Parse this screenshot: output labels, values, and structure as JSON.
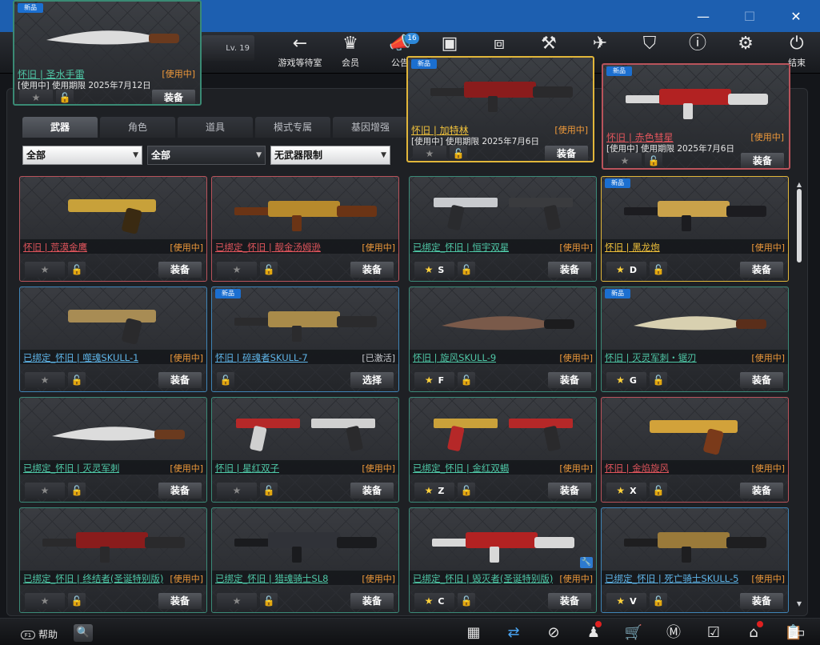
{
  "window": {
    "minimize": "—",
    "maximize": "☐",
    "close": "✕"
  },
  "profile": {
    "level": "Lv. 19"
  },
  "nav": [
    {
      "label": "游戏等待室",
      "icon": "back-arrow-icon",
      "glyph": "←"
    },
    {
      "label": "会员",
      "icon": "crown-icon",
      "glyph": "♛"
    },
    {
      "label": "公告",
      "icon": "megaphone-icon",
      "glyph": "📣"
    },
    {
      "label": "",
      "icon": "calendar-icon",
      "glyph": "▣"
    },
    {
      "label": "",
      "icon": "bag-icon",
      "glyph": "⧈"
    },
    {
      "label": "",
      "icon": "hammer-icon",
      "glyph": "⚒"
    },
    {
      "label": "",
      "icon": "ticket-icon",
      "glyph": "✈"
    },
    {
      "label": "",
      "icon": "clan-shield-icon",
      "glyph": "⛉"
    },
    {
      "label": "",
      "icon": "alert-icon",
      "glyph": "ⓘ"
    },
    {
      "label": "",
      "icon": "settings-gear-icon",
      "glyph": "⚙"
    },
    {
      "label": "结束",
      "icon": "power-icon",
      "glyph": "⏻"
    }
  ],
  "notice_badge": "16",
  "tabs": [
    "武器",
    "角色",
    "道具",
    "模式专属",
    "基因增强"
  ],
  "filters": {
    "category": "全部",
    "type": "全部",
    "restriction": "无武器限制"
  },
  "popups": [
    {
      "tag": "新品",
      "name": "怀旧 | 圣水手雷",
      "status": "[使用中]",
      "expiry": "[使用中] 使用期限 2025年7月12日",
      "action": "装备",
      "star": "★"
    },
    {
      "tag": "新品",
      "name": "怀旧 | 加特林",
      "status": "[使用中]",
      "expiry": "[使用中] 使用期限 2025年7月6日",
      "action": "装备",
      "star": "★"
    },
    {
      "tag": "新品",
      "name": "怀旧 | 赤色彗星",
      "status": "[使用中]",
      "expiry": "[使用中] 使用期限 2025年7月6日",
      "action": "装备",
      "star": "★"
    }
  ],
  "items": [
    {
      "tag": "",
      "name": "怀旧 | 荒漠金鹰",
      "status": "[使用中]",
      "action": "装备",
      "star": "★",
      "key": "",
      "color": "red",
      "lock": "gold",
      "gun": "pistol-gold"
    },
    {
      "tag": "",
      "name": "已绑定_怀旧 | 靓金汤姆逊",
      "status": "[使用中]",
      "action": "装备",
      "star": "★",
      "key": "",
      "color": "red",
      "lock": "gold",
      "gun": "smg-gold"
    },
    {
      "tag": "",
      "name": "已绑定_怀旧 | 恒宇双星",
      "status": "[使用中]",
      "action": "装备",
      "star": "★",
      "key": "S",
      "color": "teal",
      "lock": "gold",
      "gun": "dual-silver"
    },
    {
      "tag": "新品",
      "name": "怀旧 | 黑龙炮",
      "status": "[使用中]",
      "action": "装备",
      "star": "★",
      "key": "D",
      "color": "gold",
      "lock": "blue",
      "gun": "dragon-cannon"
    },
    {
      "tag": "",
      "name": "已绑定_怀旧 | 噬魂SKULL-1",
      "status": "[使用中]",
      "action": "装备",
      "star": "★",
      "key": "",
      "color": "blue",
      "lock": "gold",
      "gun": "revolver"
    },
    {
      "tag": "新品",
      "name": "怀旧 | 碎魂者SKULL-7",
      "status": "[已激活]",
      "action": "选择",
      "star": "",
      "key": "",
      "color": "blue",
      "lock": "blue",
      "gun": "mg-gold"
    },
    {
      "tag": "",
      "name": "怀旧 | 旋风SKULL-9",
      "status": "[使用中]",
      "action": "装备",
      "star": "★",
      "key": "F",
      "color": "teal",
      "lock": "gold",
      "gun": "axe"
    },
    {
      "tag": "新品",
      "name": "怀旧 | 灭灵军刺・锯刃",
      "status": "[使用中]",
      "action": "装备",
      "star": "★",
      "key": "G",
      "color": "teal",
      "lock": "blue",
      "gun": "knife-saw"
    },
    {
      "tag": "",
      "name": "已绑定_怀旧 | 灭灵军刺",
      "status": "[使用中]",
      "action": "装备",
      "star": "★",
      "key": "",
      "color": "teal",
      "lock": "gold",
      "gun": "knife"
    },
    {
      "tag": "",
      "name": "怀旧 | 星红双子",
      "status": "[使用中]",
      "action": "装备",
      "star": "★",
      "key": "",
      "color": "teal",
      "lock": "gold",
      "gun": "dual-red"
    },
    {
      "tag": "",
      "name": "已绑定_怀旧 | 金红双蝎",
      "status": "[使用中]",
      "action": "装备",
      "star": "★",
      "key": "Z",
      "color": "teal",
      "lock": "gold",
      "gun": "dual-gold"
    },
    {
      "tag": "",
      "name": "怀旧 | 金焰旋风",
      "status": "[使用中]",
      "action": "装备",
      "star": "★",
      "key": "X",
      "color": "red",
      "lock": "gold",
      "gun": "flare"
    },
    {
      "tag": "",
      "name": "已绑定_怀旧 | 终结者(圣诞特别版)",
      "status": "[使用中]",
      "action": "装备",
      "star": "★",
      "key": "",
      "color": "teal",
      "lock": "gold",
      "gun": "minigun"
    },
    {
      "tag": "",
      "name": "已绑定_怀旧 | 猎魂骑士SL8",
      "status": "[使用中]",
      "action": "装备",
      "star": "★",
      "key": "",
      "color": "teal",
      "lock": "gold",
      "gun": "sniper"
    },
    {
      "tag": "",
      "name": "已绑定_怀旧 | 毁灭者(圣诞特别版)",
      "status": "[使用中]",
      "action": "装备",
      "star": "★",
      "key": "C",
      "color": "teal",
      "lock": "gold",
      "gun": "mg-xmas"
    },
    {
      "tag": "",
      "name": "已绑定_怀旧 | 死亡骑士SKULL-5",
      "status": "[使用中]",
      "action": "装备",
      "star": "★",
      "key": "V",
      "color": "blue",
      "lock": "gold",
      "gun": "rifle-gold"
    }
  ],
  "footer": {
    "help_key": "F1",
    "help_label": "帮助",
    "search_icon": "🔍",
    "icons": [
      {
        "name": "calendar-icon",
        "glyph": "▦"
      },
      {
        "name": "swap-icon",
        "glyph": "⇄"
      },
      {
        "name": "compass-icon",
        "glyph": "⊘"
      },
      {
        "name": "runner-icon",
        "glyph": "♟"
      },
      {
        "name": "cart-icon",
        "glyph": "🛒"
      },
      {
        "name": "mall-icon",
        "glyph": "Ⓜ"
      },
      {
        "name": "checklist-icon",
        "glyph": "☑"
      },
      {
        "name": "home-icon",
        "glyph": "⌂"
      },
      {
        "name": "clipboard-icon",
        "glyph": "📋"
      },
      {
        "name": "battery-icon",
        "glyph": "▭"
      }
    ]
  }
}
